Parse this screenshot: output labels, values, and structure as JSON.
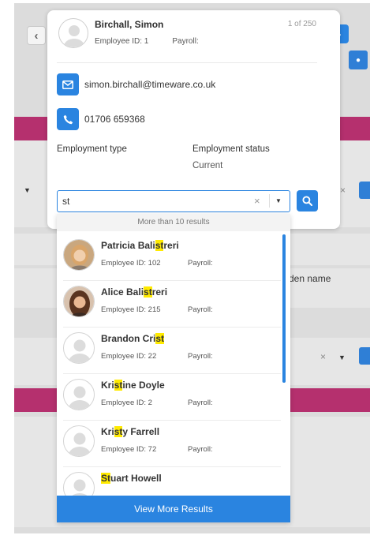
{
  "navigation": {
    "prev_icon": "chevron-left-icon",
    "next_icon": "chevron-right-icon"
  },
  "employee": {
    "name": "Birchall, Simon",
    "employee_id": "Employee ID: 1",
    "payroll": "Payroll:",
    "counter": "1 of 250",
    "email": "simon.birchall@timeware.co.uk",
    "phone": "01706 659368",
    "employment_type_label": "Employment type",
    "employment_status_label": "Employment status",
    "employment_status_value": "Current"
  },
  "search": {
    "value": "st",
    "clear_icon": "×",
    "results_count": "More than 10 results",
    "view_more_label": "View More Results"
  },
  "results": [
    {
      "name_parts": [
        "Patricia Bali",
        "st",
        "reri"
      ],
      "employee_id": "Employee ID: 102",
      "payroll": "Payroll:",
      "avatar": "photo"
    },
    {
      "name_parts": [
        "Alice Bali",
        "st",
        "reri"
      ],
      "employee_id": "Employee ID: 215",
      "payroll": "Payroll:",
      "avatar": "photo"
    },
    {
      "name_parts": [
        "Brandon Cri",
        "st",
        ""
      ],
      "employee_id": "Employee ID: 22",
      "payroll": "Payroll:",
      "avatar": "placeholder"
    },
    {
      "name_parts": [
        "Kri",
        "st",
        "ine Doyle"
      ],
      "employee_id": "Employee ID: 2",
      "payroll": "Payroll:",
      "avatar": "placeholder"
    },
    {
      "name_parts": [
        "Kri",
        "st",
        "y Farrell"
      ],
      "employee_id": "Employee ID: 72",
      "payroll": "Payroll:",
      "avatar": "placeholder"
    },
    {
      "name_parts": [
        "",
        "St",
        "uart Howell"
      ],
      "employee_id": "",
      "payroll": "",
      "avatar": "placeholder"
    }
  ],
  "background": {
    "right_label": "den name"
  },
  "colors": {
    "accent": "#2a84e0",
    "band": "#b5306e",
    "highlight": "#ffea00"
  }
}
